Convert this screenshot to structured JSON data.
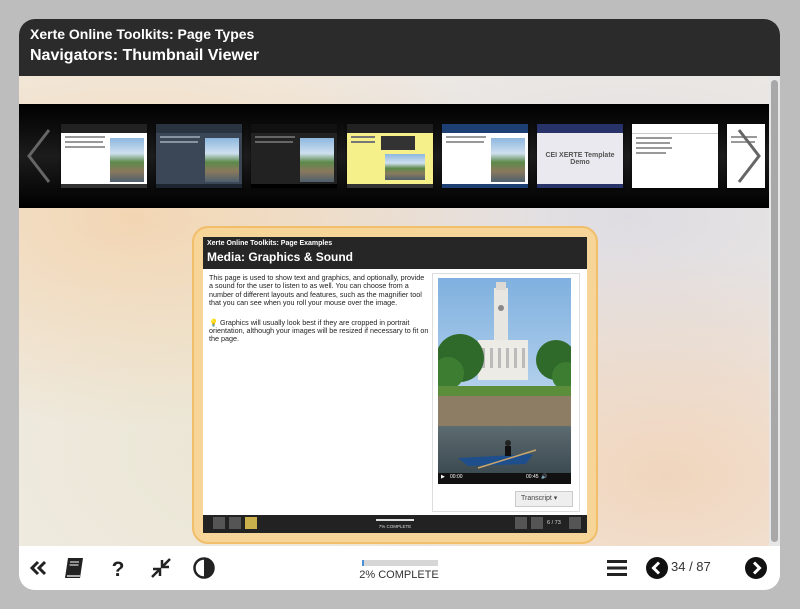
{
  "header": {
    "title": "Xerte Online Toolkits: Page Types",
    "subtitle": "Navigators: Thumbnail Viewer"
  },
  "thumbnails": [
    {
      "title": "Media: Graphics & Sound",
      "theme": "white"
    },
    {
      "title": "Media: Graphics & Sound",
      "theme": "slate"
    },
    {
      "title": "Media: Graphics & Sound",
      "theme": "black"
    },
    {
      "title": "Navigators: Hotspot Navigator",
      "theme": "yellow"
    },
    {
      "title": "Media: Graphics & Sound",
      "theme": "blue"
    },
    {
      "title": "CEI XERTE Template Demo",
      "theme": "grey"
    },
    {
      "title": "Introduction",
      "theme": "white-bars"
    }
  ],
  "preview": {
    "kicker": "Xerte Online Toolkits: Page Examples",
    "title": "Media: Graphics & Sound",
    "paragraph1": "This page is used to show text and graphics, and optionally, provide a sound for the user to listen to as well. You can choose from a number of different layouts and features, such as the magnifier tool that you can see when you roll your mouse over the image.",
    "paragraph2": "Graphics will usually look best if they are cropped in portrait orientation, although your images will be resized if necessary to fit on the page.",
    "player_time_start": "00:00",
    "player_time_end": "00:45",
    "transcript_label": "Transcript",
    "progress_label": "7% COMPLETE",
    "page_label": "6 / 73"
  },
  "footer": {
    "progress_text": "2% COMPLETE",
    "progress_percent": 2,
    "page_count": "34 / 87"
  },
  "colors": {
    "header_bg": "#2b2b2b",
    "card_border": "#f1be6a",
    "accent": "#4a90d9"
  },
  "icons": [
    "double-chevron-left-icon",
    "glossary-book-icon",
    "help-icon",
    "collapse-icon",
    "contrast-icon",
    "menu-icon",
    "chevron-left-circle-icon",
    "chevron-right-circle-icon"
  ]
}
